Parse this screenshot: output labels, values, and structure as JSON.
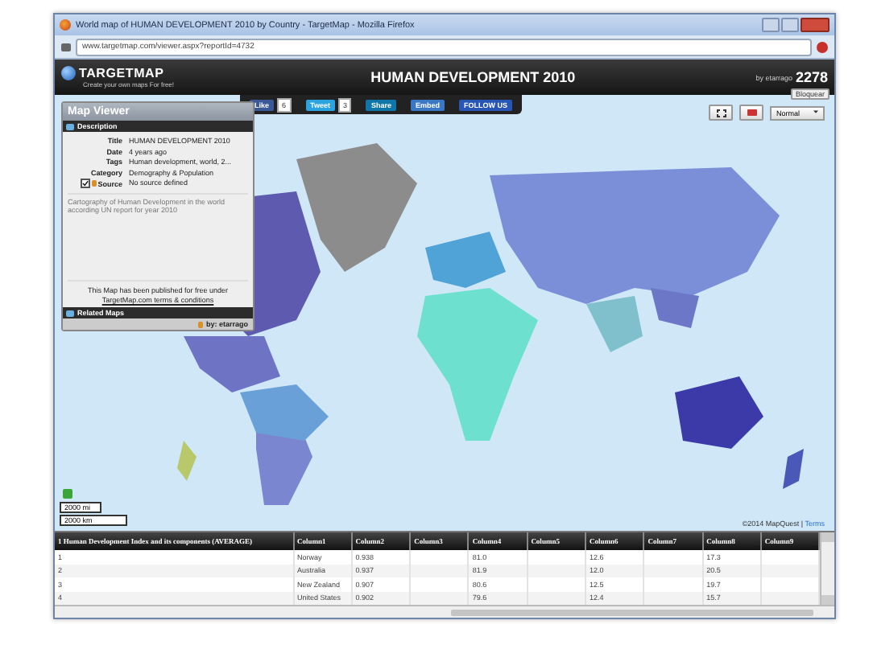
{
  "window": {
    "title": "World map of HUMAN DEVELOPMENT 2010 by Country - TargetMap - Mozilla Firefox"
  },
  "address_bar": {
    "url": "www.targetmap.com/viewer.aspx?reportId=4732"
  },
  "header": {
    "logo": "TARGETMAP",
    "tagline": "Create your own maps For free!",
    "title": "HUMAN DEVELOPMENT 2010",
    "author": "by etarrago",
    "views": "2278",
    "block_button": "Bloquear"
  },
  "share_bar": [
    {
      "kind": "like",
      "label": "Like",
      "count": "6"
    },
    {
      "kind": "tweet",
      "label": "Tweet",
      "count": "3"
    },
    {
      "kind": "share",
      "label": "Share"
    },
    {
      "kind": "embed",
      "label": "Embed"
    },
    {
      "kind": "follow",
      "label": "FOLLOW US"
    }
  ],
  "map_viewer": {
    "heading": "Map Viewer",
    "description_tab": "Description",
    "fields": [
      {
        "label": "Title",
        "value": "HUMAN DEVELOPMENT 2010"
      },
      {
        "label": "Date",
        "value": "4 years ago"
      },
      {
        "label": "Tags",
        "value": "Human development, world, 2..."
      },
      {
        "label": "Category",
        "value": "Demography & Population"
      }
    ],
    "source": {
      "label": "Source",
      "value": "No source defined",
      "checked": true
    },
    "text": "Cartography of Human Development in the world according UN report  for year 2010",
    "publish_note": "This Map has been published for free under",
    "terms_link": "TargetMap.com terms & conditions",
    "related_tab": "Related Maps",
    "byline": "by: etarrago"
  },
  "map_controls": {
    "view_mode": "Normal"
  },
  "scale": [
    "2000 mi",
    "2000 km"
  ],
  "attribution": {
    "text": "©2014 MapQuest |",
    "link": "Terms"
  },
  "table": {
    "columns": [
      "1 Human Development Index and its components (AVERAGE)",
      "Column1",
      "Column2",
      "Column3",
      "Column4",
      "Column5",
      "Column6",
      "Column7",
      "Column8",
      "Column9"
    ],
    "rows": [
      [
        "1",
        "Norway",
        "0.938",
        null,
        "81.0",
        null,
        "12.6",
        null,
        "17.3",
        null
      ],
      [
        "2",
        "Australia",
        "0.937",
        null,
        "81.9",
        null,
        "12.0",
        null,
        "20.5",
        null
      ],
      [
        "3",
        "New Zealand",
        "0.907",
        null,
        "80.6",
        null,
        "12.5",
        null,
        "19.7",
        null
      ],
      [
        "4",
        "United States",
        "0.902",
        null,
        "79.6",
        null,
        "12.4",
        null,
        "15.7",
        null
      ]
    ]
  }
}
